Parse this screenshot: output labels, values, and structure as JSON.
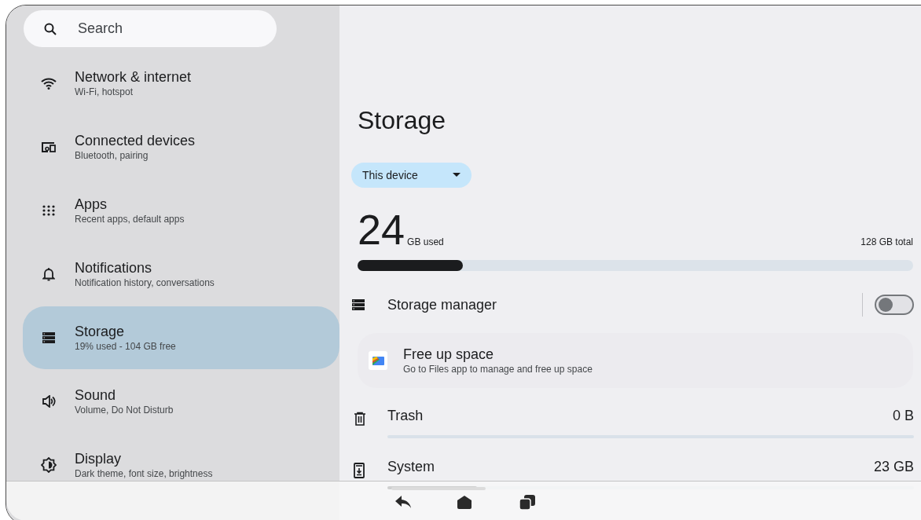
{
  "search": {
    "placeholder": "Search"
  },
  "sidebar": {
    "items": [
      {
        "title": "Network & internet",
        "subtitle": "Wi-Fi, hotspot",
        "selected": false
      },
      {
        "title": "Connected devices",
        "subtitle": "Bluetooth, pairing",
        "selected": false
      },
      {
        "title": "Apps",
        "subtitle": "Recent apps, default apps",
        "selected": false
      },
      {
        "title": "Notifications",
        "subtitle": "Notification history, conversations",
        "selected": false
      },
      {
        "title": "Storage",
        "subtitle": "19% used - 104 GB free",
        "selected": true
      },
      {
        "title": "Sound",
        "subtitle": "Volume, Do Not Disturb",
        "selected": false
      },
      {
        "title": "Display",
        "subtitle": "Dark theme, font size, brightness",
        "selected": false
      }
    ]
  },
  "page": {
    "title": "Storage",
    "volume_dropdown": "This device",
    "used_amount": "24",
    "used_unit": "GB used",
    "total": "128 GB total",
    "usage": {
      "level": 0.19
    },
    "storage_manager": {
      "label": "Storage manager",
      "on": false
    },
    "free_up_space": {
      "title": "Free up space",
      "subtitle": "Go to Files app to manage and free up space"
    },
    "categories": [
      {
        "name": "Trash",
        "size": "0 B"
      },
      {
        "name": "System",
        "size": "23 GB",
        "level": 0.17
      }
    ]
  }
}
